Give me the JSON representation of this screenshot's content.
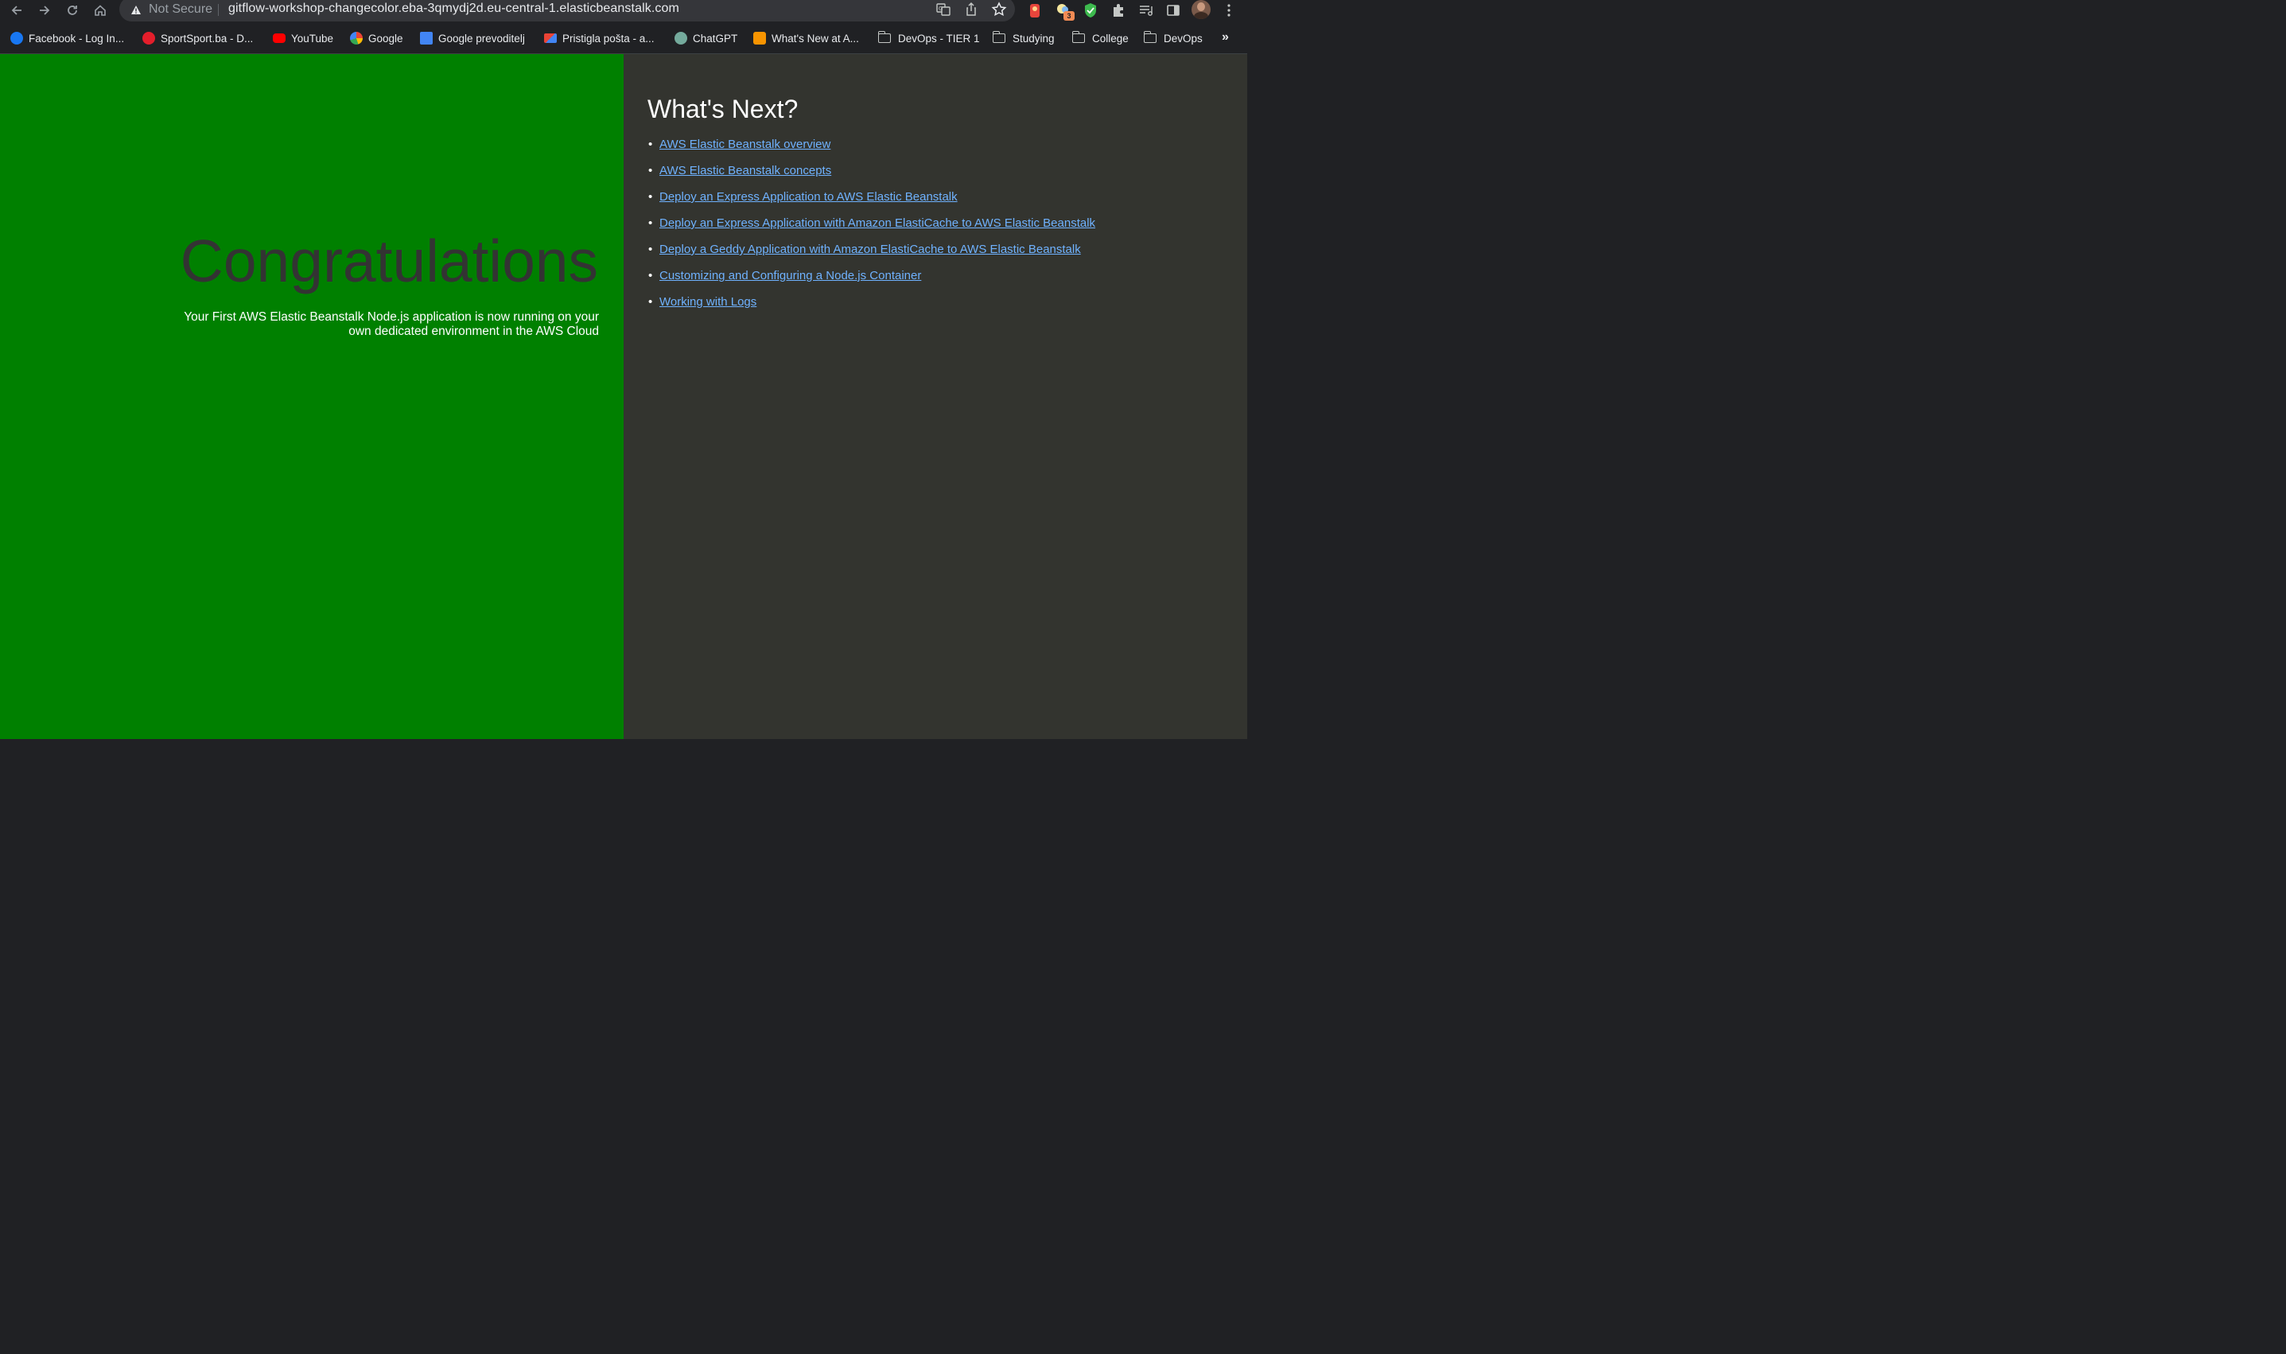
{
  "browser": {
    "security_label": "Not Secure",
    "url": "gitflow-workshop-changecolor.eba-3qmydj2d.eu-central-1.elasticbeanstalk.com",
    "extension_badge": "3",
    "icons": [
      "back-icon",
      "forward-icon",
      "reload-icon",
      "home-icon",
      "warning-icon",
      "translate-icon",
      "share-icon",
      "bookmark-star-icon",
      "extension-icon",
      "puzzle-icon",
      "reading-list-icon",
      "side-panel-icon",
      "profile-avatar",
      "menu-icon"
    ]
  },
  "bookmarks": {
    "items": [
      {
        "label": "Facebook - Log In...",
        "icon": "facebook-icon"
      },
      {
        "label": "SportSport.ba - D...",
        "icon": "sportsport-icon"
      },
      {
        "label": "YouTube",
        "icon": "youtube-icon"
      },
      {
        "label": "Google",
        "icon": "google-icon"
      },
      {
        "label": "Google prevoditelj",
        "icon": "google-translate-icon"
      },
      {
        "label": "Pristigla pošta - a...",
        "icon": "gmail-icon"
      },
      {
        "label": "ChatGPT",
        "icon": "chatgpt-icon"
      },
      {
        "label": "What's New at A...",
        "icon": "aws-icon"
      },
      {
        "label": "DevOps - TIER 1",
        "icon": "folder-icon"
      },
      {
        "label": "Studying",
        "icon": "folder-icon"
      },
      {
        "label": "College",
        "icon": "folder-icon"
      },
      {
        "label": "DevOps",
        "icon": "folder-icon"
      }
    ],
    "more": "»"
  },
  "page": {
    "left": {
      "heading": "Congratulations",
      "message": "Your First AWS Elastic Beanstalk Node.js application is now running on your own dedicated environment in the AWS Cloud",
      "background": "#008000"
    },
    "right": {
      "heading": "What's Next?",
      "background": "#33342f",
      "links": [
        "AWS Elastic Beanstalk overview",
        "AWS Elastic Beanstalk concepts",
        "Deploy an Express Application to AWS Elastic Beanstalk",
        "Deploy an Express Application with Amazon ElastiCache to AWS Elastic Beanstalk",
        "Deploy a Geddy Application with Amazon ElastiCache to AWS Elastic Beanstalk",
        "Customizing and Configuring a Node.js Container",
        "Working with Logs"
      ]
    }
  }
}
